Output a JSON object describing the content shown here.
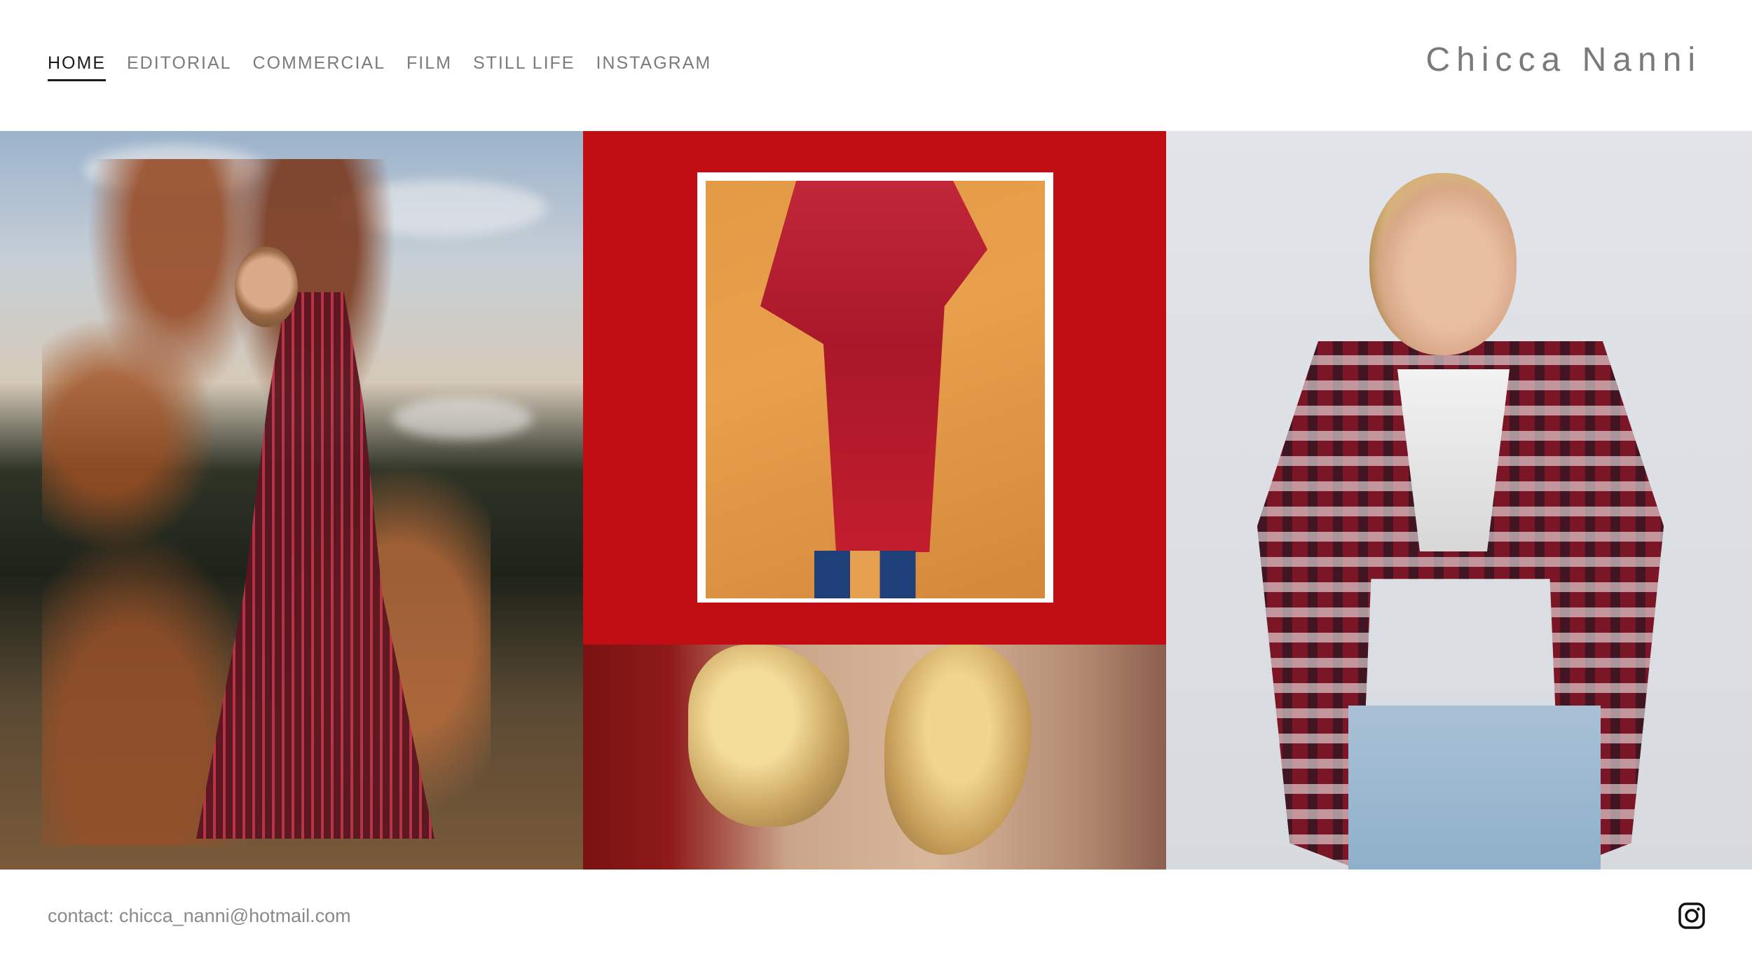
{
  "site": {
    "title": "Chicca Nanni"
  },
  "nav": {
    "items": [
      {
        "label": "HOME",
        "active": true
      },
      {
        "label": "EDITORIAL",
        "active": false
      },
      {
        "label": "COMMERCIAL",
        "active": false
      },
      {
        "label": "FILM",
        "active": false
      },
      {
        "label": "STILL LIFE",
        "active": false
      },
      {
        "label": "INSTAGRAM",
        "active": false
      }
    ]
  },
  "gallery": {
    "tiles": [
      {
        "name": "autumn-dress-photo",
        "subject": "woman in striped red dress with autumn branches"
      },
      {
        "name": "red-framed-photo",
        "subject": "framed photo of model in red outfit on red background"
      },
      {
        "name": "hair-closeup-photo",
        "subject": "close-up of blonde hair"
      },
      {
        "name": "tweed-jacket-photo",
        "subject": "woman in plaid tweed jacket and jeans"
      }
    ]
  },
  "footer": {
    "contact": "contact: chicca_nanni@hotmail.com",
    "social_icon": "instagram-icon"
  },
  "colors": {
    "text_nav": "#7b7b7b",
    "text_active": "#1a1a1a",
    "accent_red": "#c10d14",
    "background": "#ffffff"
  }
}
